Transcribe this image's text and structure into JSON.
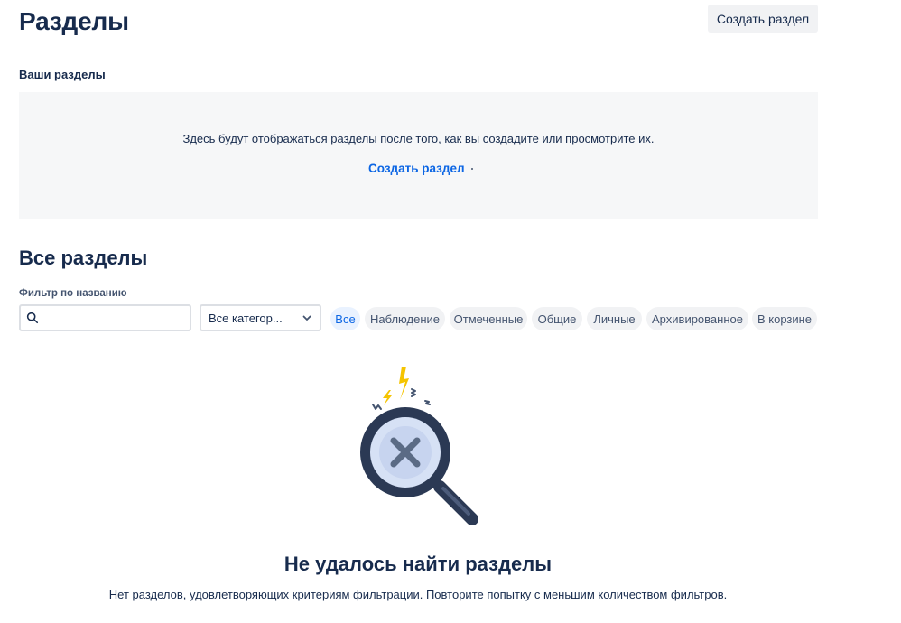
{
  "header": {
    "title": "Разделы",
    "create_button": "Создать раздел"
  },
  "your_spaces": {
    "label": "Ваши разделы",
    "empty_message": "Здесь будут отображаться разделы после того, как вы создадите или просмотрите их.",
    "create_link": "Создать раздел"
  },
  "all_spaces": {
    "title": "Все разделы",
    "filter_label": "Фильтр по названию",
    "search": {
      "value": "",
      "placeholder": ""
    },
    "category_select": "Все категор...",
    "chips": [
      {
        "label": "Все",
        "active": true
      },
      {
        "label": "Наблюдение",
        "active": false
      },
      {
        "label": "Отмеченные",
        "active": false
      },
      {
        "label": "Общие",
        "active": false
      },
      {
        "label": "Личные",
        "active": false
      },
      {
        "label": "Архивированное",
        "active": false
      },
      {
        "label": "В корзине",
        "active": false
      }
    ]
  },
  "no_results": {
    "title": "Не удалось найти разделы",
    "description": "Нет разделов, удовлетворяющих критериям фильтрации. Повторите попытку с меньшим количеством фильтров."
  },
  "colors": {
    "primary_text": "#172b4d",
    "link": "#0c66e4",
    "chip_active_bg": "#e9f2ff",
    "chip_bg": "#f1f2f4",
    "empty_box_bg": "#f6f7f8",
    "illustration_navy": "#2b3954",
    "illustration_lens": "#d0dcf2",
    "illustration_bolt": "#f5c400"
  }
}
